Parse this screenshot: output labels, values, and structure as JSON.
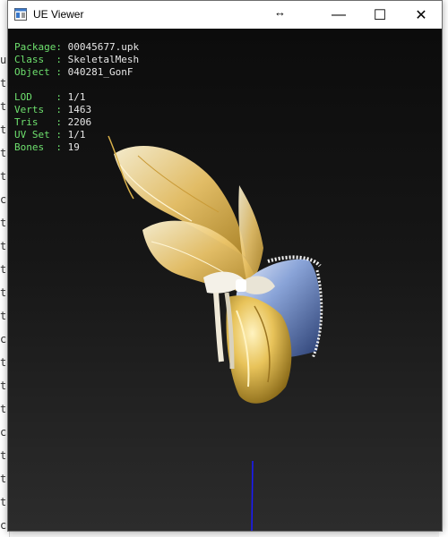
{
  "window": {
    "title": "UE Viewer"
  },
  "titlebar_buttons": {
    "resize_icon": "↔",
    "minimize": "—",
    "maximize": "☐",
    "close": "✕"
  },
  "info": {
    "package_label": "Package:",
    "package_value": "00045677.upk",
    "class_label": "Class  :",
    "class_value": "SkeletalMesh",
    "object_label": "Object :",
    "object_value": "040281_GonF",
    "lod_label": "LOD    :",
    "lod_value": "1/1",
    "verts_label": "Verts  :",
    "verts_value": "1463",
    "tris_label": "Tris   :",
    "tris_value": "2206",
    "uvset_label": "UV Set :",
    "uvset_value": "1/1",
    "bones_label": "Bones  :",
    "bones_value": "19"
  },
  "background_strip": {
    "chars": [
      "u",
      "t",
      "t",
      "t",
      "t",
      "t",
      "c",
      "t",
      "t",
      "t",
      "t",
      "t",
      "c",
      "t",
      "t",
      "t",
      "c",
      "t",
      "t",
      "t",
      "c"
    ]
  },
  "colors": {
    "label_green": "#6ee06e",
    "value_white": "#e6e6e6",
    "feather_gold": "#e8c35a",
    "hat_blue": "#8aa4d8",
    "axis_blue": "#1a1aff"
  }
}
